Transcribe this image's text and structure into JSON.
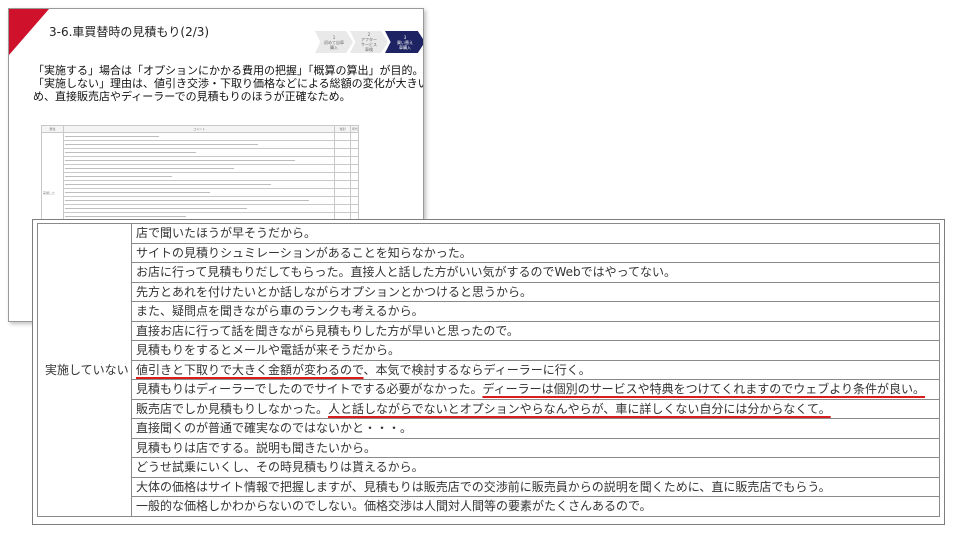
{
  "slide": {
    "title": "3-6.車買替時の見積もり(2/3)",
    "steps": [
      {
        "num": "1",
        "line1": "初めて自車",
        "line2": "購入"
      },
      {
        "num": "2",
        "line1": "アフター",
        "line2": "サービス",
        "line3": "車検"
      },
      {
        "num": "3",
        "line1": "買い替え",
        "line2": "車購入"
      }
    ],
    "summary": [
      "「実施する」場合は「オプションにかかる費用の把握」「概算の算出」が目的。",
      "「実施しない」理由は、値引き交渉・下取り価格などによる総額の変化が大きいた",
      "め、直接販売店やディーラーでの見積もりのほうが正確なため。"
    ],
    "mini_table": {
      "headers": [
        "属性",
        "コメント",
        "性別",
        "年代"
      ],
      "category": "実施した"
    }
  },
  "zoom_table": {
    "category": "実施していない",
    "rows": [
      {
        "parts": [
          {
            "t": "店で聞いたほうが早そうだから。",
            "u": false
          }
        ]
      },
      {
        "parts": [
          {
            "t": "サイトの見積りシュミレーションがあることを知らなかった。",
            "u": false
          }
        ]
      },
      {
        "parts": [
          {
            "t": "お店に行って見積もりだしてもらった。直接人と話した方がいい気がするのでWebではやってない。",
            "u": false
          }
        ]
      },
      {
        "parts": [
          {
            "t": "先方とあれを付けたいとか話しながらオプションとかつけると思うから。",
            "u": false
          }
        ]
      },
      {
        "parts": [
          {
            "t": "また、疑問点を聞きながら車のランクも考えるから。",
            "u": false
          }
        ]
      },
      {
        "parts": [
          {
            "t": "直接お店に行って話を聞きながら見積もりした方が早いと思ったので。",
            "u": false
          }
        ]
      },
      {
        "parts": [
          {
            "t": "見積もりをするとメールや電話が来そうだから。",
            "u": false
          }
        ]
      },
      {
        "parts": [
          {
            "t": "値引きと下取りで大きく金額が変わるので",
            "u": true
          },
          {
            "t": "、本気で検討するならディーラーに行く。",
            "u": false
          }
        ]
      },
      {
        "parts": [
          {
            "t": "見積もりはディーラーでしたのでサイトでする必要がなかった。",
            "u": false
          },
          {
            "t": "ディーラーは個別のサービスや特典をつけてくれますのでウェブより条件が良い。",
            "u": true
          }
        ]
      },
      {
        "parts": [
          {
            "t": "販売店でしか見積もりしなかった。",
            "u": false
          },
          {
            "t": "人と話しながらでないとオプションやらなんやらが、車に詳しくない自分には分からなくて。",
            "u": true
          }
        ]
      },
      {
        "parts": [
          {
            "t": "直接聞くのが普通で確実なのではないかと・・・。",
            "u": false
          }
        ]
      },
      {
        "parts": [
          {
            "t": "見積もりは店でする。説明も聞きたいから。",
            "u": false
          }
        ]
      },
      {
        "parts": [
          {
            "t": "どうせ試乗にいくし、その時見積もりは貰えるから。",
            "u": false
          }
        ]
      },
      {
        "parts": [
          {
            "t": "大体の価格はサイト情報で把握しますが、見積もりは販売店での交渉前に販売員からの説明を聞くために、直に販売店でもらう。",
            "u": false
          }
        ]
      },
      {
        "parts": [
          {
            "t": "一般的な価格しかわからないのでしない。価格交渉は人間対人間等の要素がたくさんあるので。",
            "u": false
          }
        ]
      }
    ]
  },
  "colors": {
    "accent": "#d0112b",
    "step_active": "#1e2463",
    "underline": "#d81e1e"
  }
}
